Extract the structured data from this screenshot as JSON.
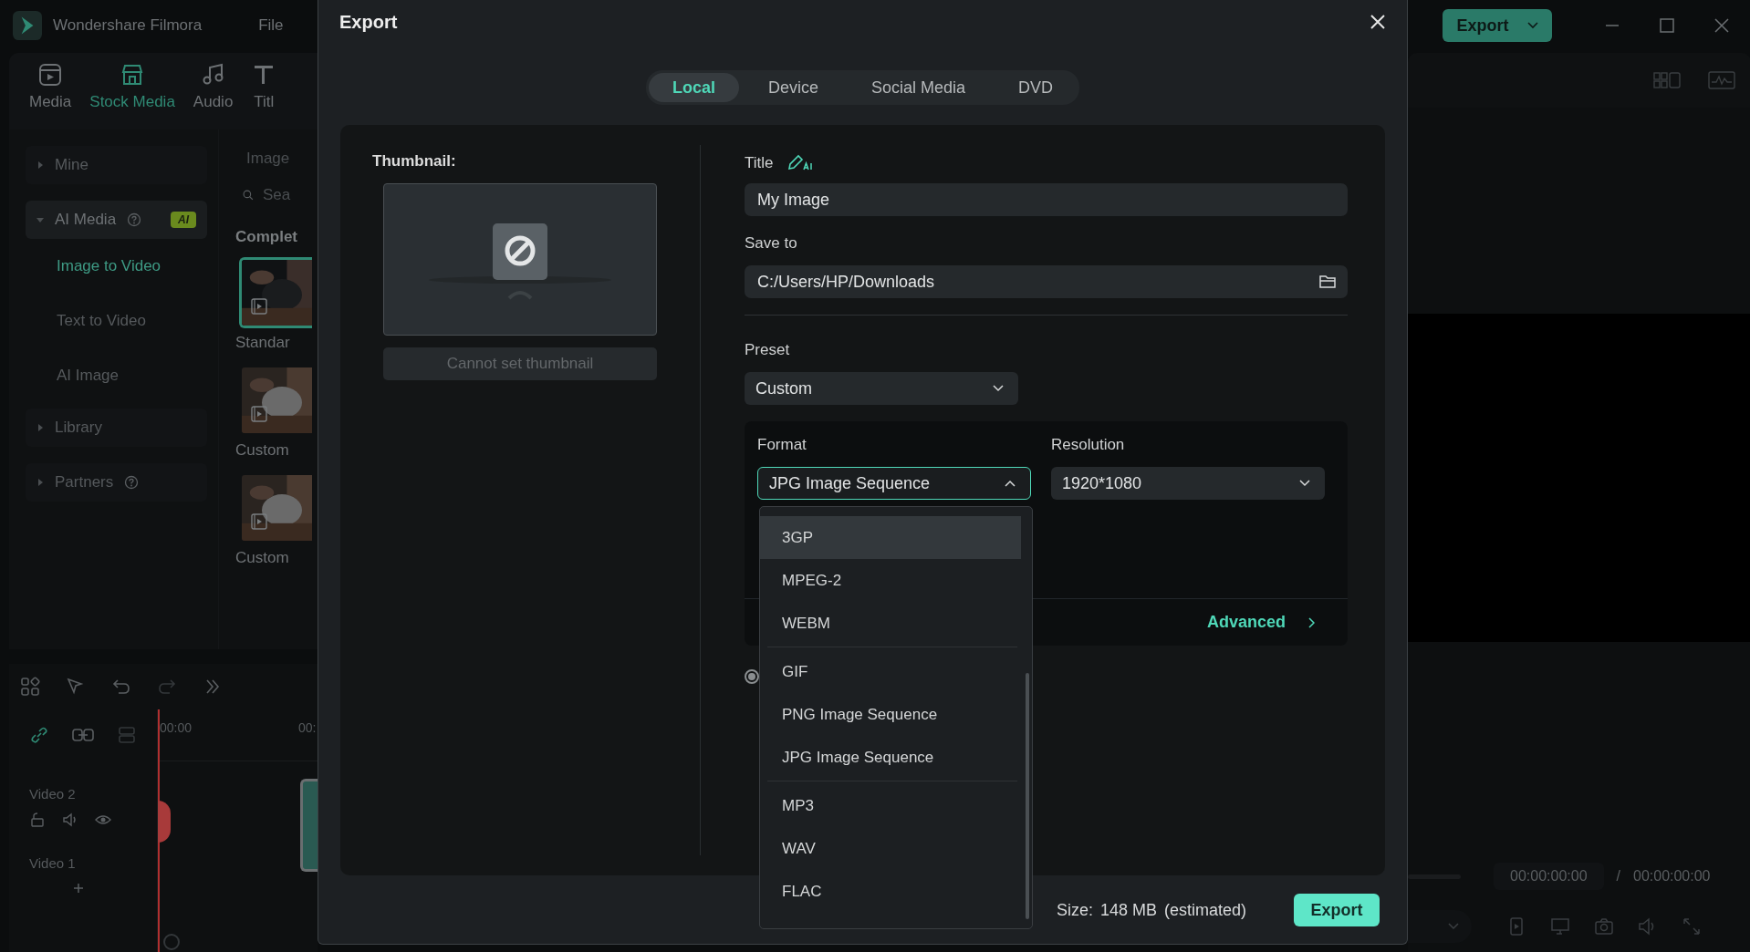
{
  "app": {
    "title": "Wondershare Filmora",
    "menu": [
      "File"
    ],
    "toolbar_tabs": [
      {
        "label": "Media",
        "selected": false
      },
      {
        "label": "Stock Media",
        "selected": true
      },
      {
        "label": "Audio",
        "selected": false
      },
      {
        "label": "Titl",
        "selected": false
      }
    ],
    "sidebar": [
      {
        "label": "Mine",
        "kind": "group",
        "expanded": false,
        "help": false
      },
      {
        "label": "AI Media",
        "kind": "group",
        "expanded": true,
        "help": true,
        "badge": "AI"
      },
      {
        "label": "Image to Video",
        "kind": "item",
        "selected": true
      },
      {
        "label": "Text to Video",
        "kind": "item",
        "selected": false
      },
      {
        "label": "AI Image",
        "kind": "item",
        "selected": false
      },
      {
        "label": "Library",
        "kind": "group",
        "expanded": false,
        "help": false
      },
      {
        "label": "Partners",
        "kind": "group",
        "expanded": false,
        "help": true
      }
    ],
    "browser": {
      "heading": "Image",
      "search_placeholder": "Sea",
      "section": "Complet",
      "items": [
        {
          "label": "Standar",
          "selected": true
        },
        {
          "label": "Custom",
          "selected": false
        },
        {
          "label": "Custom",
          "selected": false
        }
      ]
    },
    "timeline": {
      "ruler": [
        "00:00",
        "00:"
      ],
      "tracks": [
        "Video 2",
        "Video 1"
      ]
    },
    "export_button": "Export",
    "preview": {
      "current_time": "00:00:00:00",
      "separator": "/",
      "total_time": "00:00:00:00"
    }
  },
  "dialog": {
    "title": "Export",
    "tabs": [
      {
        "label": "Local",
        "selected": true
      },
      {
        "label": "Device",
        "selected": false
      },
      {
        "label": "Social Media",
        "selected": false
      },
      {
        "label": "DVD",
        "selected": false
      }
    ],
    "thumbnail": {
      "label": "Thumbnail:",
      "button": "Cannot set thumbnail"
    },
    "title_field": {
      "label": "Title",
      "value": "My Image"
    },
    "save_to": {
      "label": "Save to",
      "value": "C:/Users/HP/Downloads"
    },
    "preset": {
      "label": "Preset",
      "value": "Custom"
    },
    "format": {
      "label": "Format",
      "value": "JPG Image Sequence",
      "expanded": true,
      "groups": [
        {
          "options": [
            {
              "label": "3GP",
              "highlighted": true
            },
            {
              "label": "MPEG-2",
              "highlighted": false
            },
            {
              "label": "WEBM",
              "highlighted": false
            }
          ]
        },
        {
          "options": [
            {
              "label": "GIF",
              "highlighted": false
            },
            {
              "label": "PNG Image Sequence",
              "highlighted": false
            },
            {
              "label": "JPG Image Sequence",
              "highlighted": false
            }
          ]
        },
        {
          "options": [
            {
              "label": "MP3",
              "highlighted": false
            },
            {
              "label": "WAV",
              "highlighted": false
            },
            {
              "label": "FLAC",
              "highlighted": false
            }
          ]
        }
      ]
    },
    "resolution": {
      "label": "Resolution",
      "value": "1920*1080"
    },
    "advanced": "Advanced",
    "radio": {
      "selected": true
    },
    "size": {
      "label": "Size:",
      "value": "148 MB",
      "note": "(estimated)"
    },
    "export_button": "Export"
  }
}
